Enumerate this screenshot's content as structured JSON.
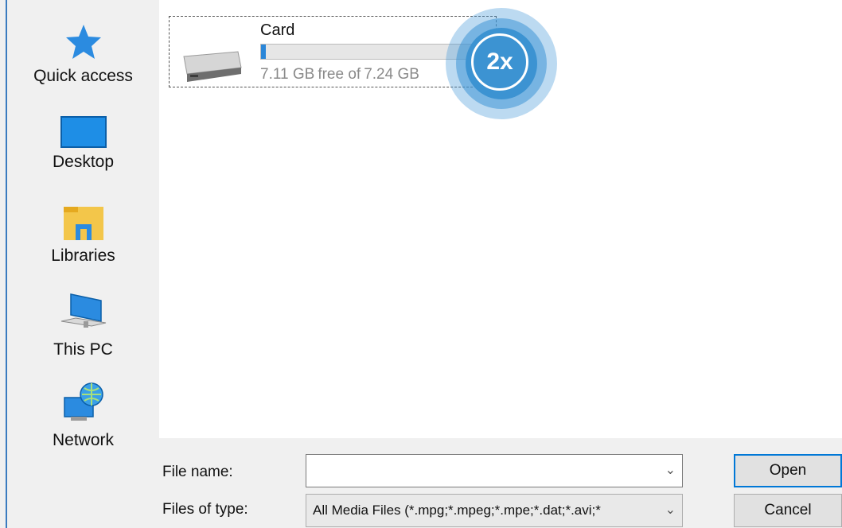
{
  "places": [
    {
      "label": "Quick access",
      "icon": "quick-access-star-icon"
    },
    {
      "label": "Desktop",
      "icon": "desktop-icon"
    },
    {
      "label": "Libraries",
      "icon": "libraries-icon"
    },
    {
      "label": "This PC",
      "icon": "this-pc-icon"
    },
    {
      "label": "Network",
      "icon": "network-icon"
    }
  ],
  "drive": {
    "name": "Card",
    "free": "7.11 GB",
    "separator": "free of",
    "total": "7.24 GB",
    "used_fraction": 0.02,
    "icon": "drive-icon"
  },
  "overlay": {
    "label": "2x"
  },
  "form": {
    "file_name_label": "File name:",
    "file_name_value": "",
    "files_of_type_label": "Files of type:",
    "files_of_type_value": "All Media Files (*.mpg;*.mpeg;*.mpe;*.dat;*.avi;*"
  },
  "buttons": {
    "open": "Open",
    "cancel": "Cancel"
  },
  "colors": {
    "accent": "#0078d7",
    "badge": "#3c93d2",
    "bar_fill": "#2a86d8"
  }
}
